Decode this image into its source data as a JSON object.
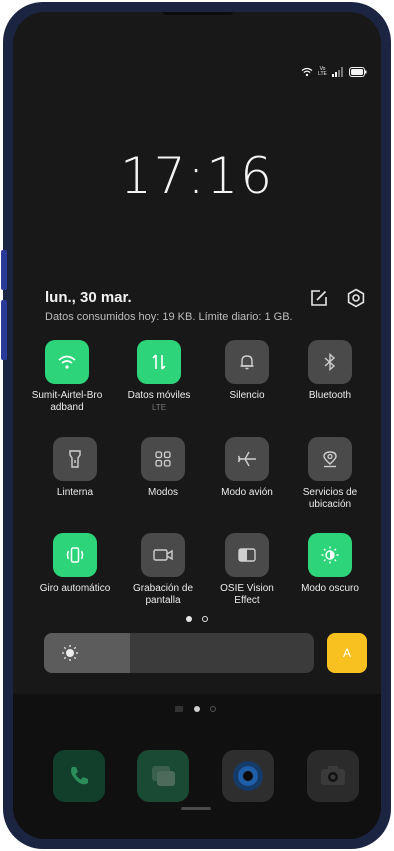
{
  "clock": {
    "time": "17:16"
  },
  "header": {
    "date": "lun., 30 mar.",
    "usage": "Datos consumidos hoy: 19 KB. Límite diario: 1 GB."
  },
  "status_bar": {
    "icons": [
      "wifi-icon",
      "volte-icon",
      "signal-icon",
      "battery-icon"
    ],
    "volte_text": "Vo LTE"
  },
  "tiles": [
    {
      "label": "Sumit-Airtel-Bro\nadband",
      "icon": "wifi-icon",
      "active": true
    },
    {
      "label": "Datos móviles",
      "sub": "LTE",
      "icon": "mobile-data-icon",
      "active": true
    },
    {
      "label": "Silencio",
      "icon": "bell-icon",
      "active": false
    },
    {
      "label": "Bluetooth",
      "icon": "bluetooth-icon",
      "active": false
    },
    {
      "label": "Linterna",
      "icon": "flashlight-icon",
      "active": false
    },
    {
      "label": "Modos",
      "icon": "modes-icon",
      "active": false
    },
    {
      "label": "Modo avión",
      "icon": "airplane-icon",
      "active": false
    },
    {
      "label": "Servicios de\nubicación",
      "icon": "location-icon",
      "active": false
    },
    {
      "label": "Giro automático",
      "icon": "auto-rotate-icon",
      "active": true
    },
    {
      "label": "Grabación de\npantalla",
      "icon": "screen-record-icon",
      "active": false
    },
    {
      "label": "OSIE Vision\nEffect",
      "icon": "vision-effect-icon",
      "active": false
    },
    {
      "label": "Modo oscuro",
      "icon": "dark-mode-icon",
      "active": true
    }
  ],
  "brightness": {
    "level": 0.32,
    "auto_label": "A"
  },
  "colors": {
    "accent": "#2ed47a",
    "auto": "#f8c11f",
    "tile_off": "#4a4a4a"
  },
  "pager": {
    "pages": 2,
    "current": 1
  },
  "home_pager": {
    "pages": 3,
    "current": 2
  },
  "dock": [
    "phone-icon",
    "messages-icon",
    "browser-icon",
    "camera-icon"
  ]
}
